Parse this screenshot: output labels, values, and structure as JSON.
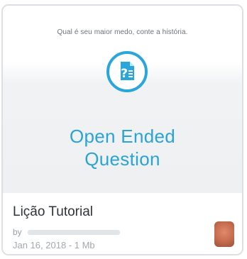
{
  "card": {
    "question_text": "Qual é seu maior medo, conte a história.",
    "type_label": "Open Ended\nQuestion",
    "icon": "question-document-icon",
    "title": "Lição Tutorial",
    "author_prefix": "by",
    "meta": "Jan 16, 2018 - 1 Mb",
    "avatar": "user-avatar"
  },
  "colors": {
    "accent": "#2aa3d6",
    "border": "#dcdfe3",
    "title": "#2f3438",
    "muted": "#a3a9af"
  }
}
